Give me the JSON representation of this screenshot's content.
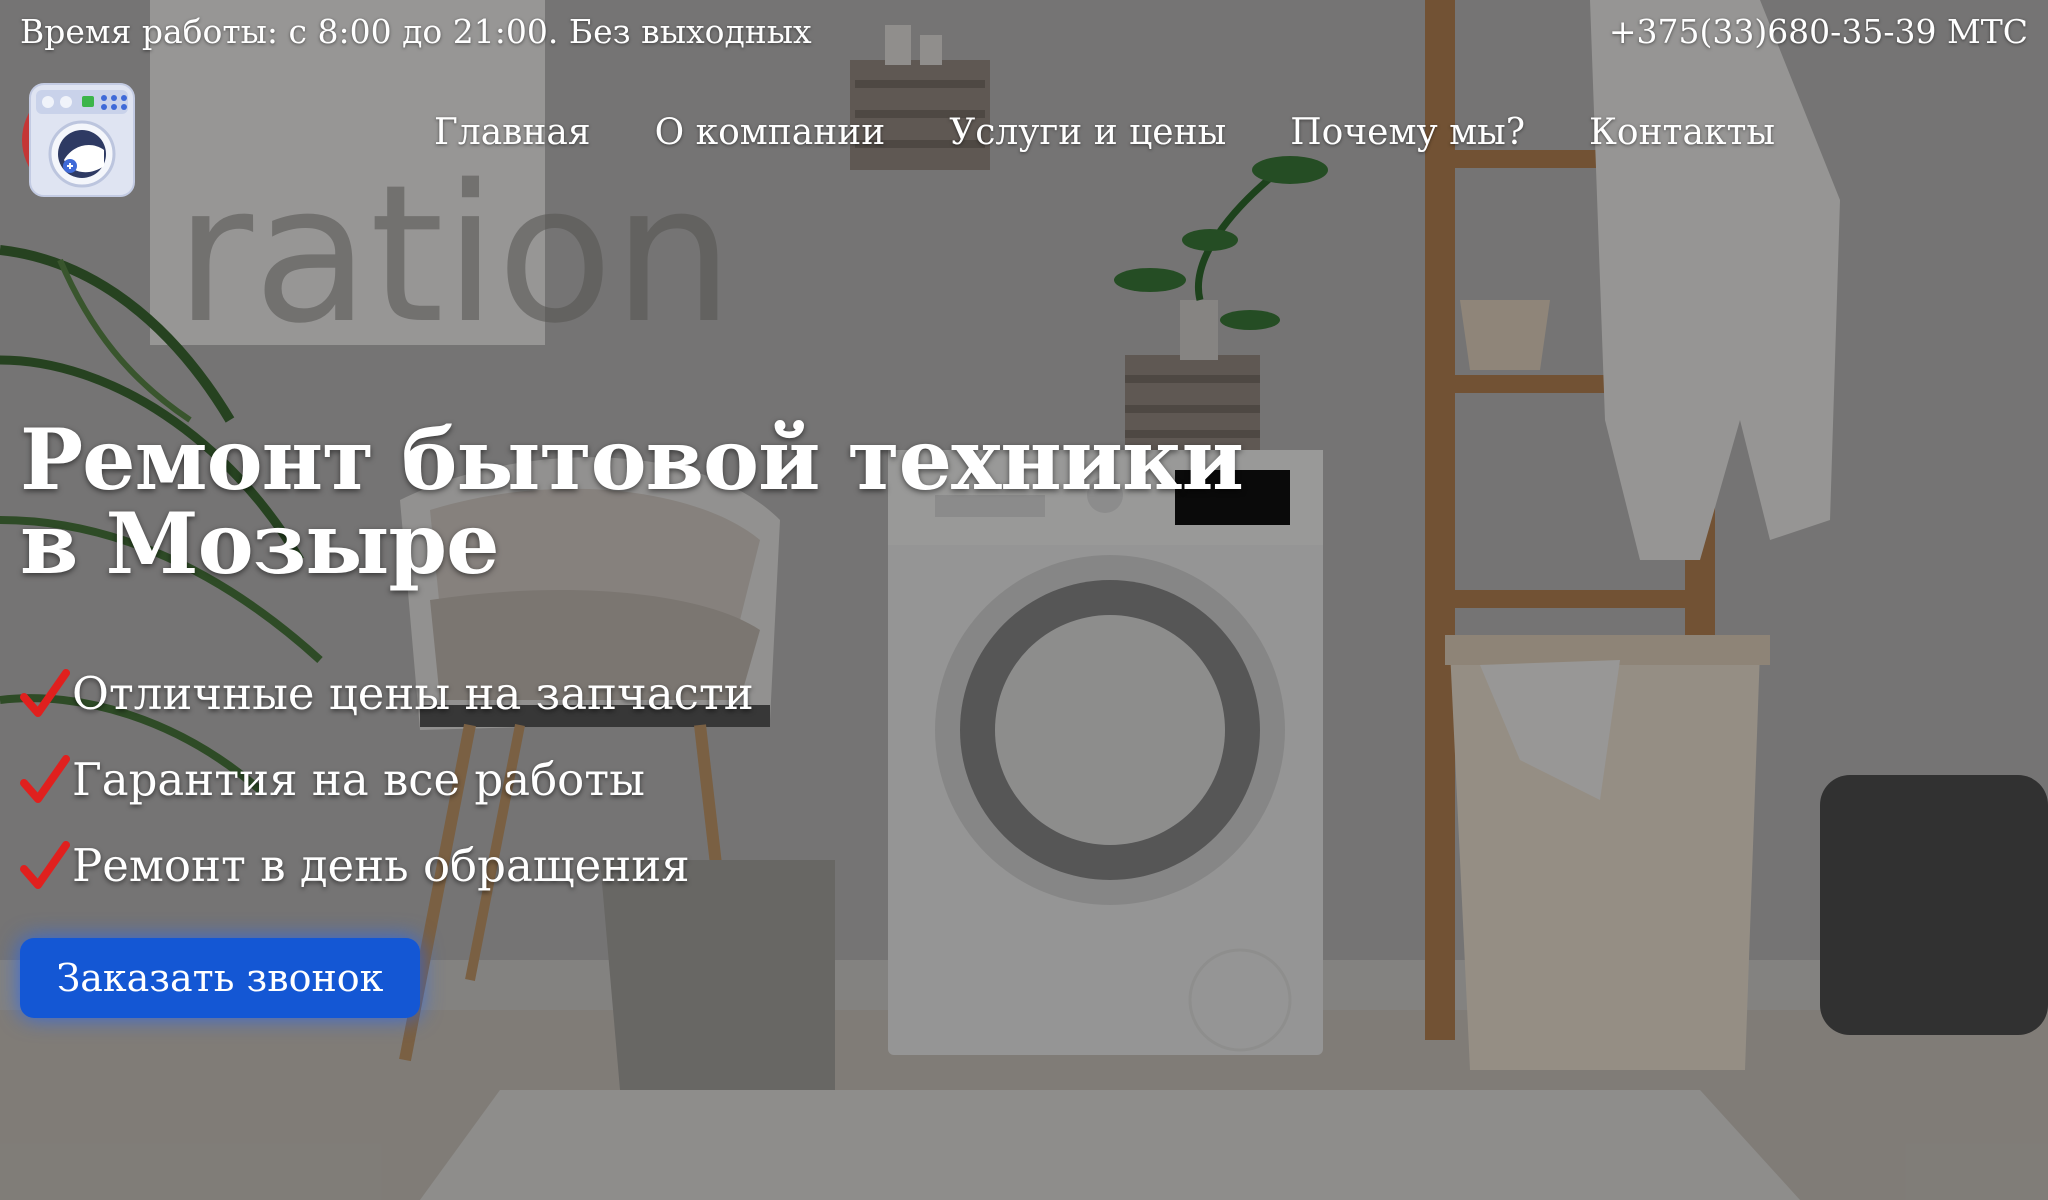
{
  "topbar": {
    "hours": "Время работы: с 8:00 до 21:00. Без выходных",
    "phone": "+375(33)680-35-39 МТС"
  },
  "logo": {
    "icon": "washing-machine-icon"
  },
  "nav": {
    "items": [
      {
        "label": "Главная"
      },
      {
        "label": "О компании"
      },
      {
        "label": "Услуги и цены"
      },
      {
        "label": "Почему мы?"
      },
      {
        "label": "Контакты"
      }
    ]
  },
  "hero": {
    "title_line1": "Ремонт бытовой техники",
    "title_line2": "в Мозыре",
    "features": [
      "Отличные цены на запчасти",
      "Гарантия на все работы",
      "Ремонт в день обращения"
    ],
    "check_icon": "checkmark-icon",
    "check_color": "#e0201e",
    "cta_label": "Заказать звонок",
    "cta_color": "#1457d4"
  },
  "background": {
    "poster_text": "ration"
  }
}
